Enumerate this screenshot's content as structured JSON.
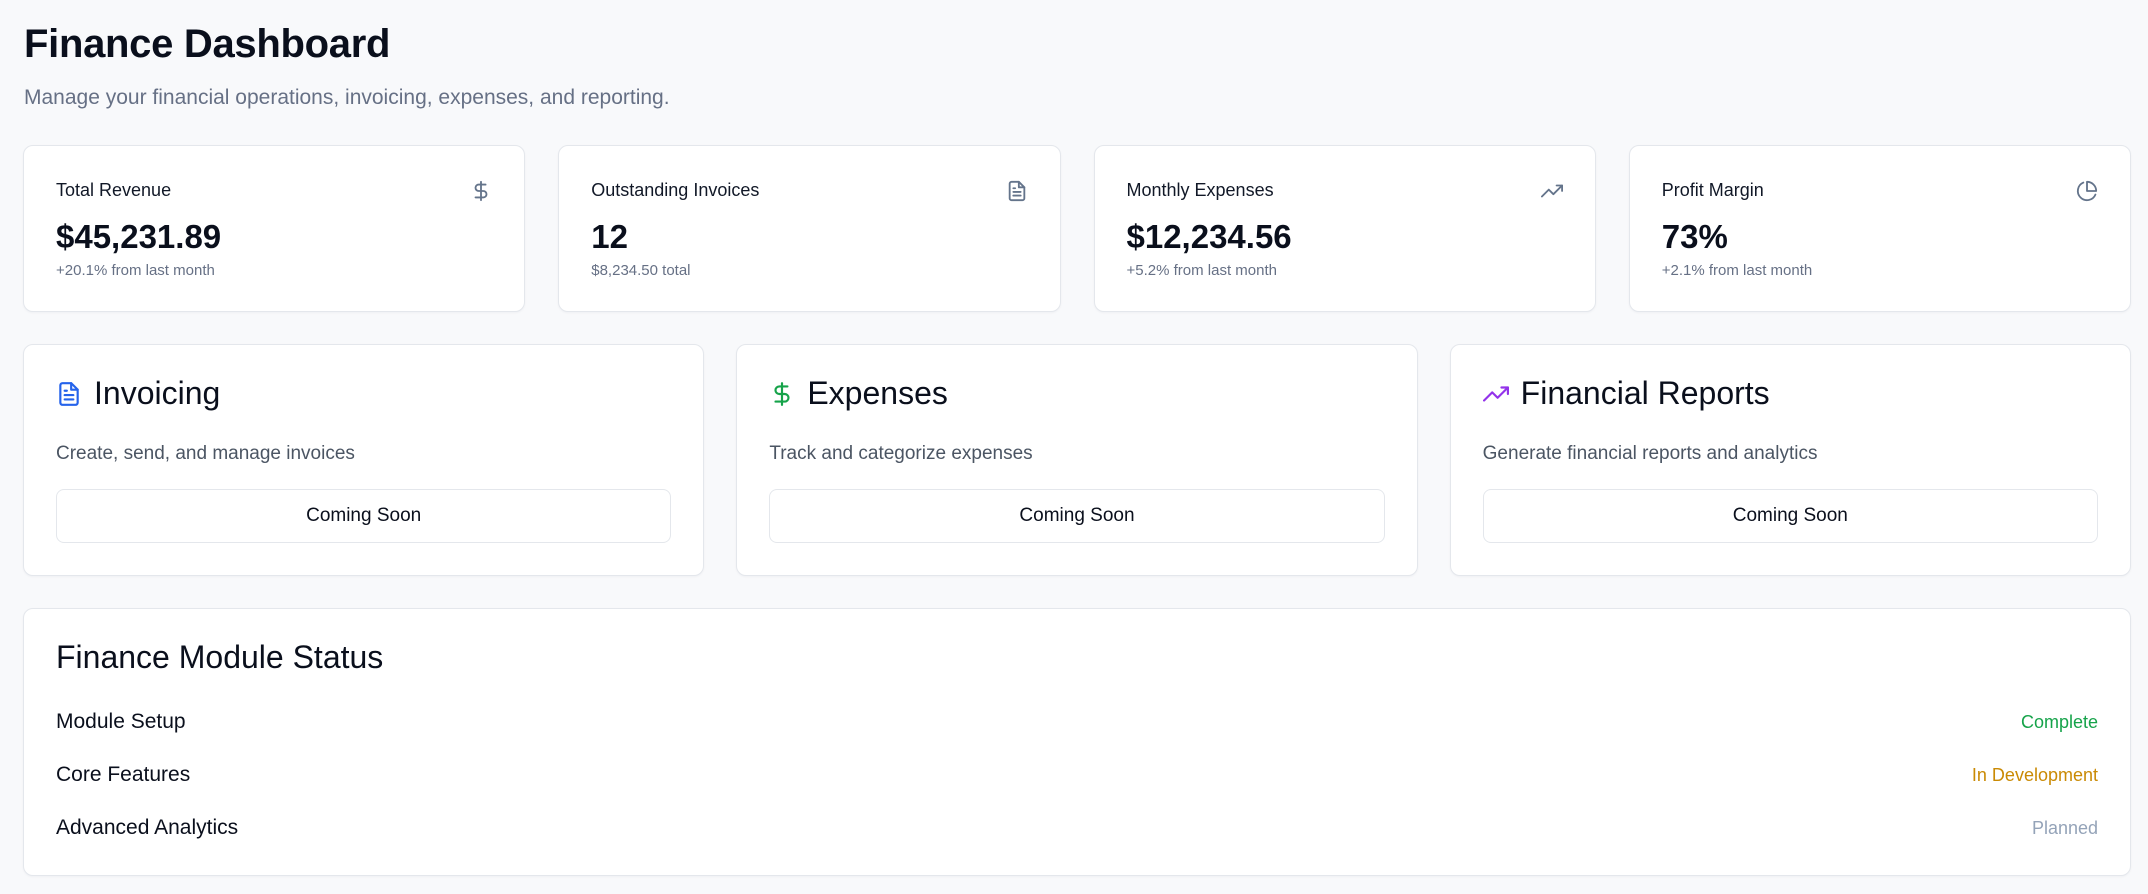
{
  "header": {
    "title": "Finance Dashboard",
    "subtitle": "Manage your financial operations, invoicing, expenses, and reporting."
  },
  "stats": [
    {
      "label": "Total Revenue",
      "value": "$45,231.89",
      "sub": "+20.1% from last month",
      "icon": "dollar-icon"
    },
    {
      "label": "Outstanding Invoices",
      "value": "12",
      "sub": "$8,234.50 total",
      "icon": "file-text-icon"
    },
    {
      "label": "Monthly Expenses",
      "value": "$12,234.56",
      "sub": "+5.2% from last month",
      "icon": "trending-up-icon"
    },
    {
      "label": "Profit Margin",
      "value": "73%",
      "sub": "+2.1% from last month",
      "icon": "pie-chart-icon"
    }
  ],
  "modules": [
    {
      "title": "Invoicing",
      "description": "Create, send, and manage invoices",
      "button": "Coming Soon",
      "icon": "file-text-icon",
      "color": "#2563eb"
    },
    {
      "title": "Expenses",
      "description": "Track and categorize expenses",
      "button": "Coming Soon",
      "icon": "dollar-icon",
      "color": "#16a34a"
    },
    {
      "title": "Financial Reports",
      "description": "Generate financial reports and analytics",
      "button": "Coming Soon",
      "icon": "trending-up-icon",
      "color": "#9333ea"
    }
  ],
  "status": {
    "title": "Finance Module Status",
    "rows": [
      {
        "name": "Module Setup",
        "state": "Complete",
        "color": "#16a34a"
      },
      {
        "name": "Core Features",
        "state": "In Development",
        "color": "#ca8a04"
      },
      {
        "name": "Advanced Analytics",
        "state": "Planned",
        "color": "#94a3b8"
      }
    ]
  }
}
